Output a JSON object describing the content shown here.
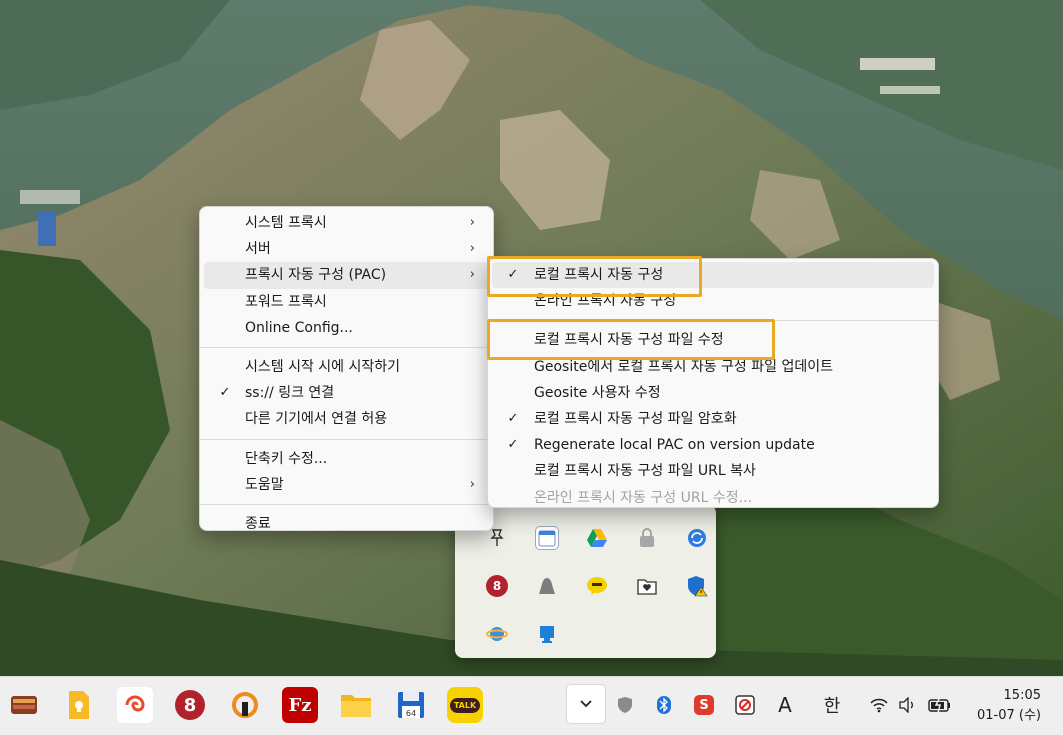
{
  "main_menu": {
    "items": [
      {
        "label": "시스템 프록시",
        "submenu": true
      },
      {
        "label": "서버",
        "submenu": true
      },
      {
        "label": "프록시 자동 구성 (PAC)",
        "submenu": true,
        "highlighted": true
      },
      {
        "label": "포워드 프록시"
      },
      {
        "label": "Online Config..."
      },
      {
        "separator": true
      },
      {
        "label": "시스템 시작 시에 시작하기"
      },
      {
        "label": "ss:// 링크 연결",
        "checked": true
      },
      {
        "label": "다른 기기에서 연결 허용"
      },
      {
        "separator": true
      },
      {
        "label": "단축키 수정..."
      },
      {
        "label": "도움말",
        "submenu": true
      },
      {
        "separator": true
      },
      {
        "label": "종료"
      }
    ]
  },
  "pac_submenu": {
    "items": [
      {
        "label": "로컬 프록시 자동 구성",
        "checked": true,
        "highlighted": true
      },
      {
        "label": "온라인 프록시 자동 구성"
      },
      {
        "separator": true
      },
      {
        "label": "로컬 프록시 자동 구성 파일 수정"
      },
      {
        "label": "Geosite에서 로컬 프록시 자동 구성 파일 업데이트"
      },
      {
        "label": "Geosite 사용자 수정"
      },
      {
        "label": "로컬 프록시 자동 구성 파일 암호화",
        "checked": true
      },
      {
        "label": "Regenerate local PAC on version update",
        "checked": true
      },
      {
        "label": "로컬 프록시 자동 구성 파일 URL 복사"
      },
      {
        "label": "온라인 프록시 자동 구성 URL 수정...",
        "disabled": true
      }
    ]
  },
  "tray_overflow": {
    "icons": [
      "pin-icon",
      "calendar-icon",
      "google-drive-icon",
      "lock-icon",
      "sync-icon",
      "app-8-icon",
      "ghost-icon",
      "kakaotalk-chat-icon",
      "folder-heart-icon",
      "security-warning-icon",
      "globe-icon",
      "monitor-icon"
    ]
  },
  "taskbar": {
    "apps": [
      "book-app-icon",
      "note-app-icon",
      "browser-swirl-app-icon",
      "app-8-icon",
      "vpn-app-icon",
      "filezilla-icon",
      "file-explorer-icon",
      "floppy-save-app-icon",
      "kakaotalk-icon"
    ],
    "filezilla_glyph": "Fz",
    "kakaotalk_glyph": "TALK",
    "floppy_glyph": "64",
    "app8_glyph": "8",
    "tray": {
      "ime_english": "A",
      "ime_korean": "한",
      "clock_time": "15:05",
      "clock_date": "01-07 (수)",
      "s_glyph": "S"
    }
  },
  "colors": {
    "menu_bg": "#f9f9f9",
    "highlight_box": "#e9a825",
    "taskbar_bg": "#efefef",
    "tray_flyout_bg": "#eef0e8"
  }
}
